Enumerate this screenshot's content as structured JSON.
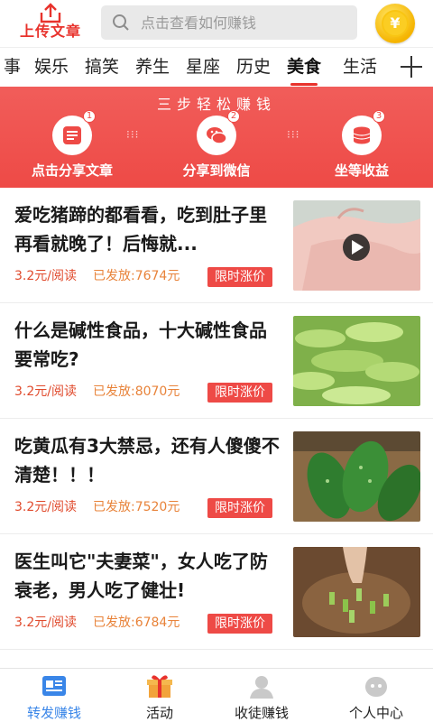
{
  "header": {
    "upload_label": "上传文章",
    "search_placeholder": "点击查看如何赚钱",
    "coin_symbol": "¥"
  },
  "tabs": [
    {
      "label": "事"
    },
    {
      "label": "娱乐"
    },
    {
      "label": "搞笑"
    },
    {
      "label": "养生"
    },
    {
      "label": "星座"
    },
    {
      "label": "历史"
    },
    {
      "label": "美食",
      "active": true
    },
    {
      "label": "生活"
    }
  ],
  "banner": {
    "title": "三步轻松赚钱",
    "steps": [
      {
        "num": "1",
        "label": "点击分享文章",
        "icon": "article-icon"
      },
      {
        "num": "2",
        "label": "分享到微信",
        "icon": "wechat-icon"
      },
      {
        "num": "3",
        "label": "坐等收益",
        "icon": "coins-icon"
      }
    ]
  },
  "articles": [
    {
      "title": "爱吃猪蹄的都看看，吃到肚子里再看就晚了！后悔就...",
      "price": "3.2元/阅读",
      "sent": "已发放:7674元",
      "tag": "限时涨价",
      "thumb": "pig-trotter-video-thumbnail"
    },
    {
      "title": "什么是碱性食品，十大碱性食品要常吃?",
      "price": "3.2元/阅读",
      "sent": "已发放:8070元",
      "tag": "限时涨价",
      "thumb": "celery-thumbnail"
    },
    {
      "title": "吃黄瓜有3大禁忌，还有人傻傻不清楚！！！",
      "price": "3.2元/阅读",
      "sent": "已发放:7520元",
      "tag": "限时涨价",
      "thumb": "cucumber-thumbnail"
    },
    {
      "title": "医生叫它\"夫妻菜\"，女人吃了防衰老，男人吃了健壮!",
      "price": "3.2元/阅读",
      "sent": "已发放:6784元",
      "tag": "限时涨价",
      "thumb": "chopped-vegetable-thumbnail"
    }
  ],
  "bottom_nav": [
    {
      "label": "转发赚钱",
      "icon": "forward-earn-icon",
      "active": true
    },
    {
      "label": "活动",
      "icon": "gift-icon"
    },
    {
      "label": "收徒赚钱",
      "icon": "apprentice-icon"
    },
    {
      "label": "个人中心",
      "icon": "profile-icon"
    }
  ],
  "colors": {
    "accent_red": "#ee4a46",
    "active_blue": "#3a86e8",
    "price_red": "#e04a2c",
    "sent_orange": "#e8833a"
  }
}
